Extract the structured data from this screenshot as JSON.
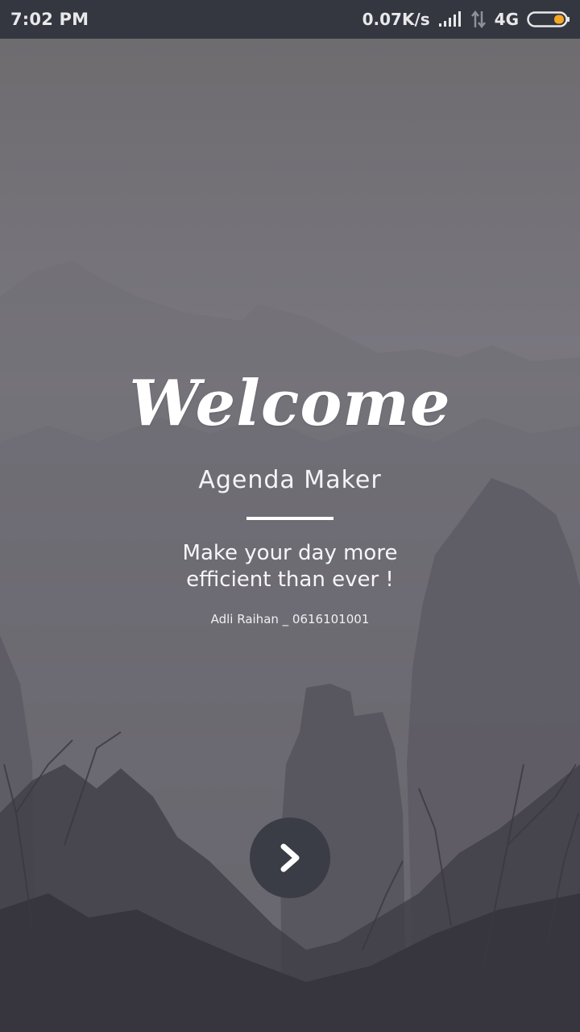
{
  "status_bar": {
    "time": "7:02 PM",
    "network_speed": "0.07K/s",
    "network_type": "4G",
    "icons": [
      "signal-icon",
      "data-transfer-icon",
      "battery-icon"
    ],
    "battery_color": "#f5a623"
  },
  "welcome_screen": {
    "title": "Welcome",
    "app_name": "Agenda Maker",
    "tagline_line1": "Make your day more",
    "tagline_line2": "efficient than ever !",
    "author": "Adli Raihan _ 0616101001",
    "next_button_icon": "chevron-right-icon"
  },
  "colors": {
    "status_bar_bg": "#343740",
    "button_bg": "#3a3d45",
    "text": "#ffffff"
  }
}
